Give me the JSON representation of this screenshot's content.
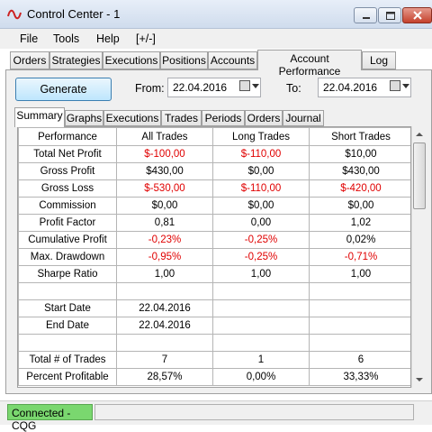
{
  "window": {
    "title": "Control Center - 1"
  },
  "menu": [
    "File",
    "Tools",
    "Help",
    "[+/-]"
  ],
  "top_tabs": [
    "Orders",
    "Strategies",
    "Executions",
    "Positions",
    "Accounts",
    "Account Performance",
    "Log"
  ],
  "toolbar": {
    "generate_label": "Generate",
    "from_label": "From:",
    "from_date": "22.04.2016",
    "to_label": "To:",
    "to_date": "22.04.2016"
  },
  "sub_tabs": [
    "Summary",
    "Graphs",
    "Executions",
    "Trades",
    "Periods",
    "Orders",
    "Journal"
  ],
  "table": {
    "headers": [
      "Performance",
      "All Trades",
      "Long Trades",
      "Short Trades"
    ],
    "rows": [
      [
        "Total Net Profit",
        "$-100,00",
        "$-110,00",
        "$10,00"
      ],
      [
        "Gross Profit",
        "$430,00",
        "$0,00",
        "$430,00"
      ],
      [
        "Gross Loss",
        "$-530,00",
        "$-110,00",
        "$-420,00"
      ],
      [
        "Commission",
        "$0,00",
        "$0,00",
        "$0,00"
      ],
      [
        "Profit Factor",
        "0,81",
        "0,00",
        "1,02"
      ],
      [
        "Cumulative Profit",
        "-0,23%",
        "-0,25%",
        "0,02%"
      ],
      [
        "Max. Drawdown",
        "-0,95%",
        "-0,25%",
        "-0,71%"
      ],
      [
        "Sharpe Ratio",
        "1,00",
        "1,00",
        "1,00"
      ],
      [
        "",
        "",
        "",
        ""
      ],
      [
        "Start Date",
        "22.04.2016",
        "",
        ""
      ],
      [
        "End Date",
        "22.04.2016",
        "",
        ""
      ],
      [
        "",
        "",
        "",
        ""
      ],
      [
        "Total # of Trades",
        "7",
        "1",
        "6"
      ],
      [
        "Percent Profitable",
        "28,57%",
        "0,00%",
        "33,33%"
      ]
    ],
    "negative_color": "#e00000"
  },
  "status": {
    "connection": "Connected - CQG"
  },
  "colors": {
    "status_connected": "#7ad76f",
    "title_accent": "#cc2222"
  }
}
